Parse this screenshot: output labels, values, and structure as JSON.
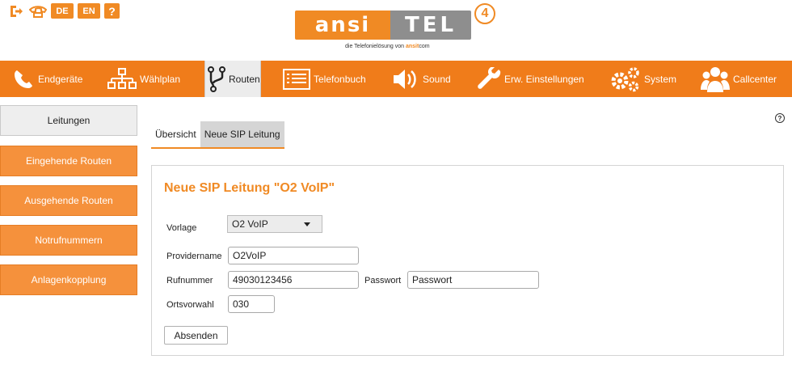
{
  "topbar": {
    "lang_de": "DE",
    "lang_en": "EN",
    "help": "?"
  },
  "logo": {
    "left_text": "ansi",
    "right_text": "TEL",
    "version": "4",
    "tagline_prefix": "die Telefonielösung von",
    "tagline_brand": "ansit",
    "tagline_suffix": "com"
  },
  "colors": {
    "accent": "#f07c1a",
    "title": "#f08a24"
  },
  "nav": {
    "items": [
      {
        "label": "Endgeräte",
        "icon": "phone-icon"
      },
      {
        "label": "Wählplan",
        "icon": "hierarchy-icon"
      },
      {
        "label": "Routen",
        "icon": "route-fork-icon",
        "active": true
      },
      {
        "label": "Telefonbuch",
        "icon": "phonebook-list-icon"
      },
      {
        "label": "Sound",
        "icon": "speaker-icon"
      },
      {
        "label": "Erw. Einstellungen",
        "icon": "wrench-icon"
      },
      {
        "label": "System",
        "icon": "gears-icon"
      },
      {
        "label": "Callcenter",
        "icon": "people-icon"
      }
    ]
  },
  "sidebar": {
    "items": [
      {
        "label": "Leitungen",
        "active": true
      },
      {
        "label": "Eingehende Routen"
      },
      {
        "label": "Ausgehende Routen"
      },
      {
        "label": "Notrufnummern"
      },
      {
        "label": "Anlagenkopplung"
      }
    ]
  },
  "tabs": [
    {
      "label": "Übersicht",
      "selected": true
    },
    {
      "label": "Neue SIP Leitung"
    }
  ],
  "form": {
    "title": "Neue SIP Leitung \"O2 VoIP\"",
    "vorlage_label": "Vorlage",
    "vorlage_value": "O2 VoIP",
    "providername_label": "Providername",
    "providername_value": "O2VoIP",
    "rufnummer_label": "Rufnummer",
    "rufnummer_value": "49030123456",
    "passwort_label": "Passwort",
    "passwort_value": "Passwort",
    "ortsvorwahl_label": "Ortsvorwahl",
    "ortsvorwahl_value": "030",
    "submit_label": "Absenden"
  }
}
